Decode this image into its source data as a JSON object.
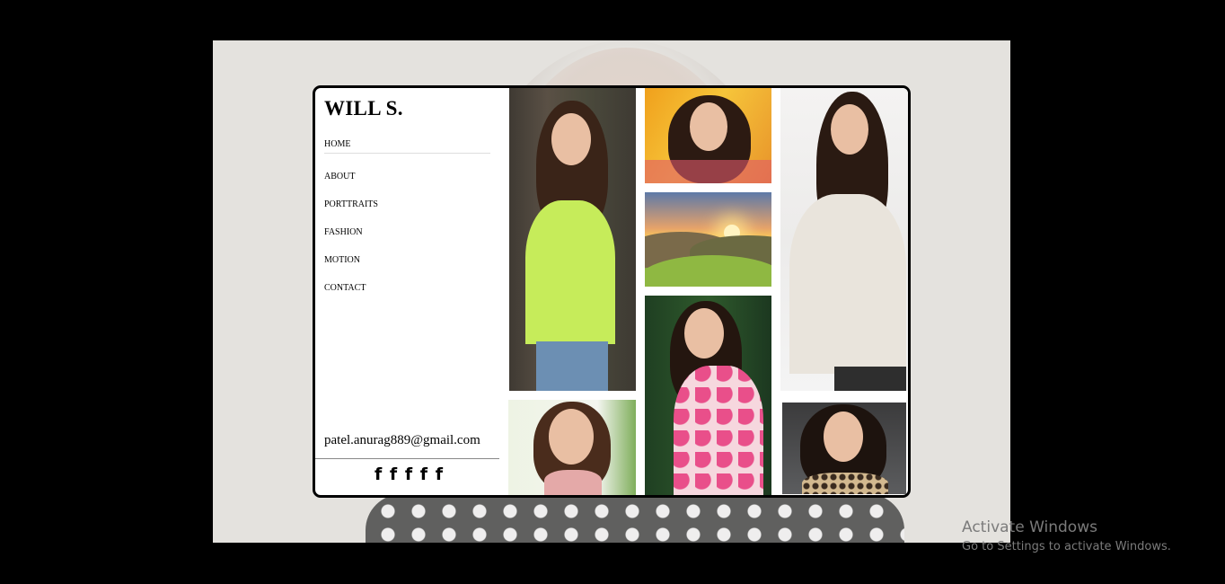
{
  "brand": {
    "name": "WILL S."
  },
  "nav": {
    "items": [
      {
        "label": "HOME"
      },
      {
        "label": "ABOUT"
      },
      {
        "label": "PORTTRAITS"
      },
      {
        "label": "FASHION"
      },
      {
        "label": "MOTION"
      },
      {
        "label": "CONTACT"
      }
    ]
  },
  "contact": {
    "email": "patel.anurag889@gmail.com"
  },
  "socials": [
    {
      "glyph": "f",
      "icon": "facebook-icon"
    },
    {
      "glyph": "f",
      "icon": "facebook-icon"
    },
    {
      "glyph": "f",
      "icon": "facebook-icon"
    },
    {
      "glyph": "f",
      "icon": "facebook-icon"
    },
    {
      "glyph": "f",
      "icon": "facebook-icon"
    }
  ],
  "gallery": {
    "photos": [
      {
        "name": "portrait-lime-top-photo"
      },
      {
        "name": "portrait-smile-photo"
      },
      {
        "name": "portrait-orange-bg-photo"
      },
      {
        "name": "sunset-landscape-photo"
      },
      {
        "name": "portrait-floral-dress-photo"
      },
      {
        "name": "portrait-white-outfit-photo"
      },
      {
        "name": "portrait-polka-dot-photo"
      }
    ]
  },
  "watermark": {
    "title": "Activate Windows",
    "subtitle": "Go to Settings to activate Windows."
  },
  "colors": {
    "page_background": "#000000",
    "backdrop": "#e4e2de",
    "card_background": "#ffffff",
    "card_border": "#000000",
    "text": "#000000"
  }
}
